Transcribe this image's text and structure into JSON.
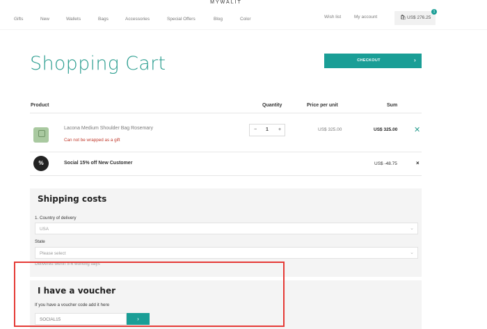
{
  "brand": {
    "logo": "MYWALIT"
  },
  "nav": {
    "items": [
      "Gifts",
      "New",
      "Wallets",
      "Bags",
      "Accessories",
      "Special Offers",
      "Blog",
      "Color"
    ],
    "wishlist": "Wish list",
    "account": "My account",
    "cart_total": "US$ 276.25",
    "cart_count": "1"
  },
  "page": {
    "title": "Shopping Cart",
    "checkout_label": "CHECKOUT"
  },
  "table": {
    "headers": {
      "product": "Product",
      "quantity": "Quantity",
      "price": "Price per unit",
      "sum": "Sum"
    }
  },
  "item": {
    "name": "Lacona Medium Shoulder Bag Rosemary",
    "note": "Can not be wrapped as a gift",
    "qty_minus": "−",
    "qty": "1",
    "qty_plus": "+",
    "price": "US$ 325.00",
    "sum": "US$ 325.00",
    "remove": "✕"
  },
  "discount": {
    "icon": "%",
    "name": "Social 15% off New Customer",
    "amount": "US$ -48.75",
    "remove": "×"
  },
  "shipping": {
    "title": "Shipping costs",
    "country_label": "1. Country of delivery",
    "country_value": "USA",
    "state_label": "State",
    "state_placeholder": "Please select",
    "delivery_note": "Delivered within 5-6 working days"
  },
  "voucher": {
    "title": "I have a voucher",
    "label": "If you have a voucher code add it here",
    "value": "SOCIAL15",
    "button": "›"
  },
  "colors": {
    "accent": "#1a9e96",
    "title": "#2a9d8f",
    "highlight": "#e53935"
  },
  "icons": {
    "cart": "shopping-bag-icon",
    "remove": "close-icon",
    "select": "chevron-down-icon",
    "submit": "chevron-right-icon"
  }
}
